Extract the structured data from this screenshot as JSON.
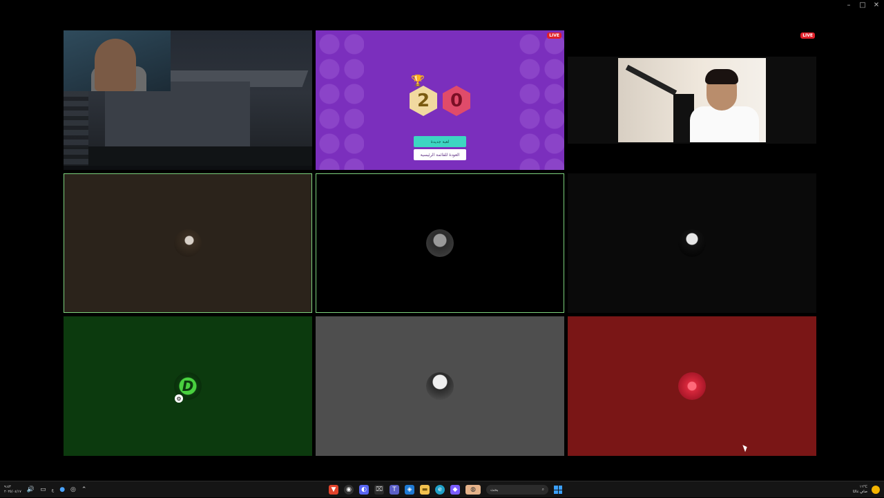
{
  "window_controls": {
    "minimize": "–",
    "maximize": "□",
    "close": "✕"
  },
  "tiles": {
    "game": {
      "live": "LIVE",
      "score_left": "2",
      "score_right": "0",
      "btn_new_game": "لعبة جديدة",
      "btn_main_menu": "العودة للقائمة الرئيسية"
    },
    "camera": {
      "live": "LIVE"
    },
    "green_badge": "⚙"
  },
  "taskbar": {
    "clock_time": "٩:٤٣",
    "clock_date": "٢٠٢٥/٠٤/١٧",
    "lang": "ع",
    "search_placeholder": "بحث",
    "weather_temp": "١٦°C",
    "weather_desc": "صافٍ غالبًا"
  },
  "icons": {
    "volume": "volume-icon",
    "network": "network-icon",
    "mic": "mic-icon",
    "chevron": "chevron-up-icon",
    "start": "windows-start-icon",
    "search": "search-icon"
  }
}
